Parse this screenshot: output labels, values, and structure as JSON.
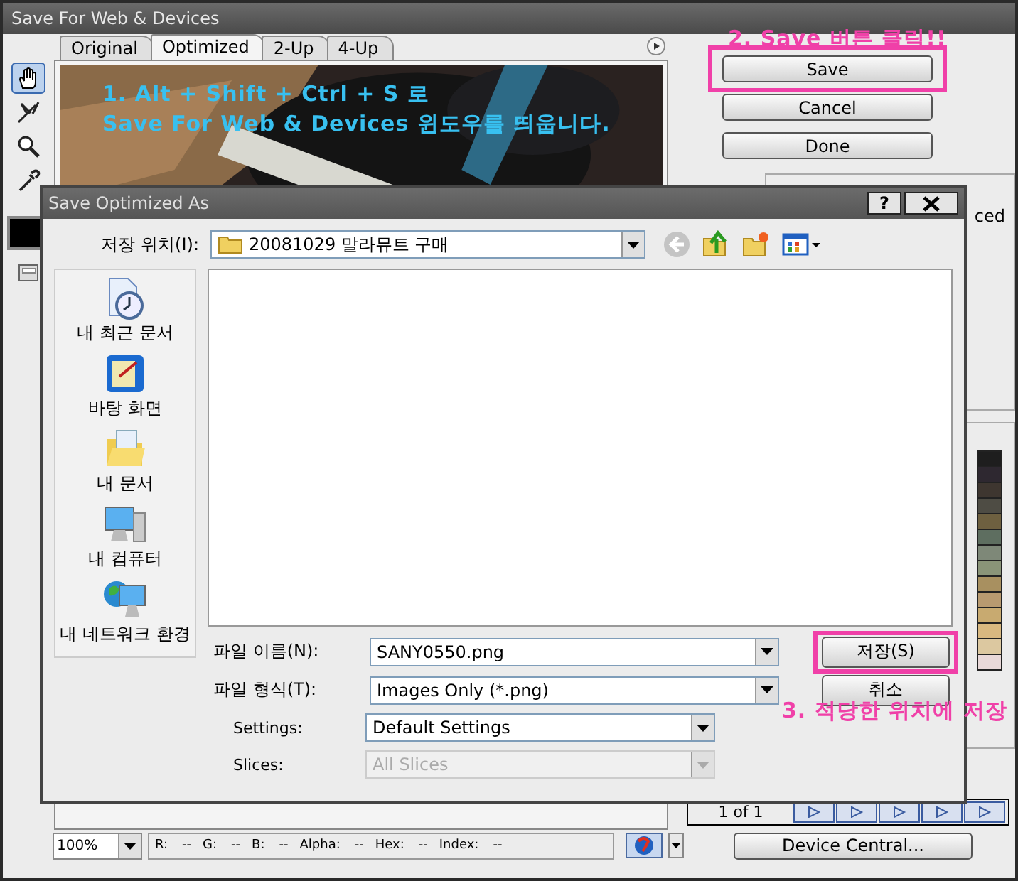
{
  "window": {
    "title": "Save For Web & Devices"
  },
  "tools": [
    {
      "kind": "hand",
      "selected": true
    },
    {
      "kind": "slice-select",
      "selected": false
    },
    {
      "kind": "zoom",
      "selected": false
    },
    {
      "kind": "eyedropper",
      "selected": false
    }
  ],
  "eyedropper_color": {
    "color": "#000000"
  },
  "tabs": [
    {
      "label": "Original",
      "selected": false
    },
    {
      "label": "Optimized",
      "selected": true
    },
    {
      "label": "2-Up",
      "selected": false
    },
    {
      "label": "4-Up",
      "selected": false
    }
  ],
  "preview_caption": [
    "1. Alt + Shift + Ctrl + S 로",
    "Save For Web & Devices 윈도우를 띄웁니다."
  ],
  "buttons": [
    {
      "label": "Save",
      "highlighted": true
    },
    {
      "label": "Cancel",
      "highlighted": false
    },
    {
      "label": "Done",
      "highlighted": false
    }
  ],
  "side_panel": {
    "label": "ced"
  },
  "palette": [
    {
      "color": "#1e1e1e"
    },
    {
      "color": "#2e2830"
    },
    {
      "color": "#3e3630"
    },
    {
      "color": "#4e4c44"
    },
    {
      "color": "#6e6040"
    },
    {
      "color": "#5e6e60"
    },
    {
      "color": "#7e8878"
    },
    {
      "color": "#8a9478"
    },
    {
      "color": "#a89060"
    },
    {
      "color": "#b89a70"
    },
    {
      "color": "#c8aa70"
    },
    {
      "color": "#d8b880"
    },
    {
      "color": "#dcc8a0"
    },
    {
      "color": "#e8d8d8"
    }
  ],
  "frame_nav": {
    "counter": "1 of 1"
  },
  "status_bar": {
    "zoom": "100%",
    "readouts": [
      {
        "label": "R:",
        "value": "--"
      },
      {
        "label": "G:",
        "value": "--"
      },
      {
        "label": "B:",
        "value": "--"
      },
      {
        "label": "Alpha:",
        "value": "--"
      },
      {
        "label": "Hex:",
        "value": "--"
      },
      {
        "label": "Index:",
        "value": "--"
      }
    ]
  },
  "device_central": "Device Central...",
  "dialog": {
    "title": "Save Optimized As",
    "help_button": "?",
    "save_in_label": "저장 위치(I):",
    "folder": "20081029 말라뮤트 구매",
    "places": [
      {
        "kind": "recent",
        "label": "내 최근 문서"
      },
      {
        "kind": "desktop",
        "label": "바탕 화면"
      },
      {
        "kind": "documents",
        "label": "내 문서"
      },
      {
        "kind": "computer",
        "label": "내 컴퓨터"
      },
      {
        "kind": "network",
        "label": "내 네트워크 환경"
      }
    ],
    "fields": [
      {
        "label": "파일 이름(N):",
        "value": "SANY0550.png",
        "disabled": false
      },
      {
        "label": "파일 형식(T):",
        "value": "Images Only (*.png)",
        "disabled": false
      },
      {
        "label": "Settings:",
        "value": "Default Settings",
        "disabled": false
      },
      {
        "label": "Slices:",
        "value": "All Slices",
        "disabled": true
      }
    ],
    "buttons": [
      {
        "label": "저장(S)",
        "highlighted": true
      },
      {
        "label": "취소",
        "highlighted": false
      }
    ]
  },
  "notes": [
    "2. Save 버튼 클릭!!",
    "3. 적당한 위치에 저장"
  ]
}
